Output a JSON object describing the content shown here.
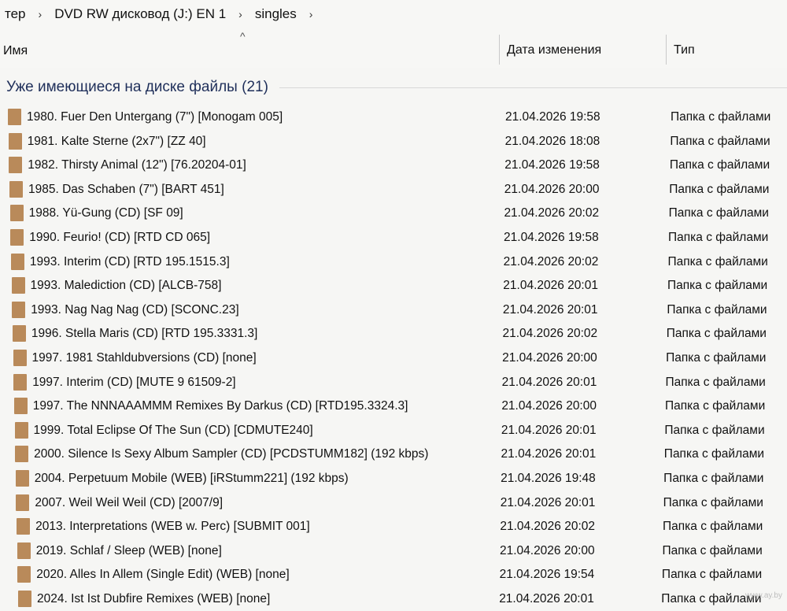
{
  "breadcrumb": {
    "items": [
      "тер",
      "DVD RW дисковод (J:) EN 1",
      "singles"
    ],
    "separator": "›"
  },
  "columns": {
    "name": "Имя",
    "date": "Дата изменения",
    "type": "Тип",
    "sort_indicator": "^"
  },
  "group": {
    "label": "Уже имеющиеся на диске файлы (21)"
  },
  "rows": [
    {
      "name": "1980. Fuer Den Untergang (7\") [Monogam 005]",
      "date": "21.04.2026 19:58",
      "type": "Папка с файлами"
    },
    {
      "name": "1981. Kalte Sterne (2x7\") [ZZ 40]",
      "date": "21.04.2026 18:08",
      "type": "Папка с файлами"
    },
    {
      "name": "1982. Thirsty Animal (12\") [76.20204-01]",
      "date": "21.04.2026 19:58",
      "type": "Папка с файлами"
    },
    {
      "name": "1985. Das Schaben (7\") [BART 451]",
      "date": "21.04.2026 20:00",
      "type": "Папка с файлами"
    },
    {
      "name": "1988. Yü-Gung (CD) [SF 09]",
      "date": "21.04.2026 20:02",
      "type": "Папка с файлами"
    },
    {
      "name": "1990. Feurio! (CD) [RTD CD 065]",
      "date": "21.04.2026 19:58",
      "type": "Папка с файлами"
    },
    {
      "name": "1993. Interim (CD) [RTD 195.1515.3]",
      "date": "21.04.2026 20:02",
      "type": "Папка с файлами"
    },
    {
      "name": "1993. Malediction (CD) [ALCB-758]",
      "date": "21.04.2026 20:01",
      "type": "Папка с файлами"
    },
    {
      "name": "1993. Nag Nag Nag (CD) [SCONC.23]",
      "date": "21.04.2026 20:01",
      "type": "Папка с файлами"
    },
    {
      "name": "1996. Stella Maris (CD) [RTD 195.3331.3]",
      "date": "21.04.2026 20:02",
      "type": "Папка с файлами"
    },
    {
      "name": "1997. 1981 Stahldubversions (CD) [none]",
      "date": "21.04.2026 20:00",
      "type": "Папка с файлами"
    },
    {
      "name": "1997. Interim (CD) [MUTE 9 61509-2]",
      "date": "21.04.2026 20:01",
      "type": "Папка с файлами"
    },
    {
      "name": "1997. The NNNAAAMMM Remixes By Darkus (CD) [RTD195.3324.3]",
      "date": "21.04.2026 20:00",
      "type": "Папка с файлами"
    },
    {
      "name": "1999. Total Eclipse Of The Sun (CD) [CDMUTE240]",
      "date": "21.04.2026 20:01",
      "type": "Папка с файлами"
    },
    {
      "name": "2000. Silence Is Sexy Album Sampler (CD) [PCDSTUMM182] (192 kbps)",
      "date": "21.04.2026 20:01",
      "type": "Папка с файлами"
    },
    {
      "name": "2004. Perpetuum Mobile (WEB) [iRStumm221] (192 kbps)",
      "date": "21.04.2026 19:48",
      "type": "Папка с файлами"
    },
    {
      "name": "2007. Weil Weil Weil (CD) [2007/9]",
      "date": "21.04.2026 20:01",
      "type": "Папка с файлами"
    },
    {
      "name": "2013. Interpretations (WEB w. Perc) [SUBMIT 001]",
      "date": "21.04.2026 20:02",
      "type": "Папка с файлами"
    },
    {
      "name": "2019. Schlaf / Sleep (WEB) [none]",
      "date": "21.04.2026 20:00",
      "type": "Папка с файлами"
    },
    {
      "name": "2020. Alles In Allem (Single Edit) (WEB) [none]",
      "date": "21.04.2026 19:54",
      "type": "Папка с файлами"
    },
    {
      "name": "2024. Ist Ist Dubfire Remixes (WEB) [none]",
      "date": "21.04.2026 20:01",
      "type": "Папка с файлами"
    }
  ],
  "watermark": "www.ay.by",
  "colors": {
    "folder": "#b98a5a",
    "group_label": "#1f2f5a",
    "background": "#f6f6f4"
  },
  "icons": {
    "row_icon": "folder-icon",
    "breadcrumb_separator": "chevron-right-icon",
    "sort": "sort-up-icon"
  }
}
